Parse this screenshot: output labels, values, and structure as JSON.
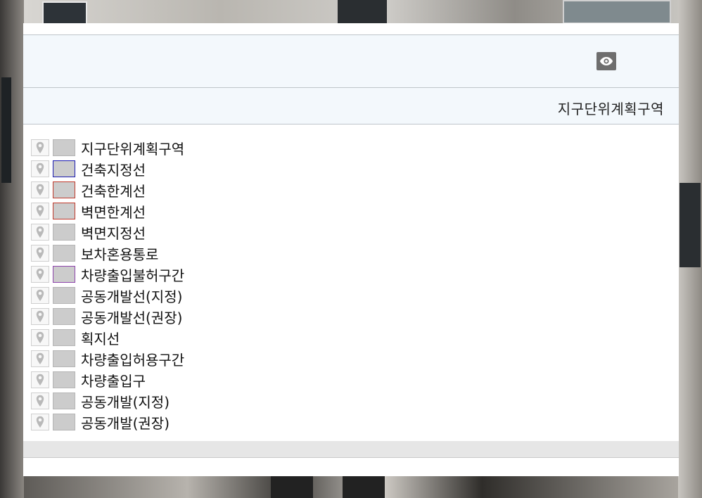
{
  "panel": {
    "visibility_button": {
      "icon": "eye-icon"
    },
    "title": "지구단위계획구역"
  },
  "legend": {
    "items": [
      {
        "label": "지구단위계획구역",
        "icon": "map-pin-icon",
        "swatch_fill": "#cccccc",
        "swatch_border": "#b5b5b5"
      },
      {
        "label": "건축지정선",
        "icon": "map-pin-icon",
        "swatch_fill": "#cccccc",
        "swatch_border": "#1a1ab0"
      },
      {
        "label": "건축한계선",
        "icon": "map-pin-icon",
        "swatch_fill": "#cccccc",
        "swatch_border": "#c0392b"
      },
      {
        "label": "벽면한계선",
        "icon": "map-pin-icon",
        "swatch_fill": "#cccccc",
        "swatch_border": "#c0392b"
      },
      {
        "label": "벽면지정선",
        "icon": "map-pin-icon",
        "swatch_fill": "#cccccc",
        "swatch_border": "#b5b5b5"
      },
      {
        "label": "보차혼용통로",
        "icon": "map-pin-icon",
        "swatch_fill": "#cccccc",
        "swatch_border": "#b5b5b5"
      },
      {
        "label": "차량출입불허구간",
        "icon": "map-pin-icon",
        "swatch_fill": "#cccccc",
        "swatch_border": "#8e44ad"
      },
      {
        "label": "공동개발선(지정)",
        "icon": "map-pin-icon",
        "swatch_fill": "#cccccc",
        "swatch_border": "#b5b5b5"
      },
      {
        "label": "공동개발선(권장)",
        "icon": "map-pin-icon",
        "swatch_fill": "#cccccc",
        "swatch_border": "#b5b5b5"
      },
      {
        "label": "획지선",
        "icon": "map-pin-icon",
        "swatch_fill": "#cccccc",
        "swatch_border": "#b5b5b5"
      },
      {
        "label": "차량출입허용구간",
        "icon": "map-pin-icon",
        "swatch_fill": "#cccccc",
        "swatch_border": "#b5b5b5"
      },
      {
        "label": "차량출입구",
        "icon": "map-pin-icon",
        "swatch_fill": "#cccccc",
        "swatch_border": "#b5b5b5"
      },
      {
        "label": "공동개발(지정)",
        "icon": "map-pin-icon",
        "swatch_fill": "#cccccc",
        "swatch_border": "#b5b5b5"
      },
      {
        "label": "공동개발(권장)",
        "icon": "map-pin-icon",
        "swatch_fill": "#cccccc",
        "swatch_border": "#b5b5b5"
      }
    ]
  }
}
